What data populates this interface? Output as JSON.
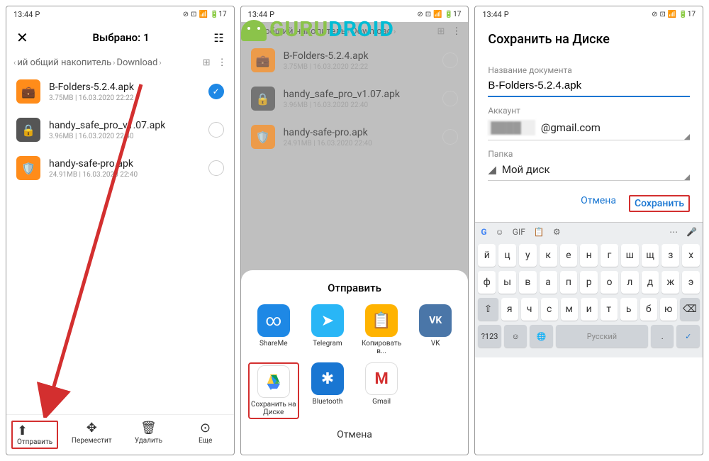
{
  "watermark": "GURUDROID",
  "status": {
    "time": "13:44",
    "carrier": "P",
    "battery": "17"
  },
  "screen1": {
    "title": "Выбрано: 1",
    "breadcrumb": {
      "part1": "ий общий накопитель",
      "part2": "Download"
    },
    "files": [
      {
        "name": "B-Folders-5.2.4.apk",
        "meta": "3.75MB | 16.03.2020 22:22",
        "icon": "orange",
        "checked": true
      },
      {
        "name": "handy_safe_pro_v1.07.apk",
        "meta": "3.96MB | 16.03.2020 22:40",
        "icon": "gray",
        "checked": false
      },
      {
        "name": "handy-safe-pro.apk",
        "meta": "24.91MB | 16.03.2020 22:40",
        "icon": "orange",
        "checked": false
      }
    ],
    "actions": {
      "send": "Отправить",
      "move": "Переместит",
      "delete": "Удалить",
      "more": "Еще"
    }
  },
  "screen2": {
    "breadcrumb": {
      "part1": "ий общий накопитель",
      "part2": "Download"
    },
    "files": [
      {
        "name": "B-Folders-5.2.4.apk",
        "meta": "3.75MB | 16.03.2020 22:22",
        "icon": "orange"
      },
      {
        "name": "handy_safe_pro_v1.07.apk",
        "meta": "3.96MB | 16.03.2020 22:40",
        "icon": "gray"
      },
      {
        "name": "handy-safe-pro.apk",
        "meta": "24.91MB | 16.03.2020 22:40",
        "icon": "orange"
      }
    ],
    "share": {
      "title": "Отправить",
      "apps": [
        {
          "name": "ShareMe",
          "color": "#1e88e5",
          "glyph": "∞"
        },
        {
          "name": "Telegram",
          "color": "#29b6f6",
          "glyph": "➤"
        },
        {
          "name": "Копировать в...",
          "color": "#ffb300",
          "glyph": "📋"
        },
        {
          "name": "VK",
          "color": "#4a76a8",
          "glyph": "VK"
        },
        {
          "name": "Сохранить на Диске",
          "color": "drive",
          "glyph": "△"
        },
        {
          "name": "Bluetooth",
          "color": "#1976d2",
          "glyph": "✱"
        },
        {
          "name": "Gmail",
          "color": "#fff",
          "glyph": "M"
        }
      ],
      "cancel": "Отмена"
    }
  },
  "screen3": {
    "title": "Сохранить на Диске",
    "docname": {
      "label": "Название документа",
      "value": "B-Folders-5.2.4.apk"
    },
    "account": {
      "label": "Аккаунт",
      "value": "@gmail.com"
    },
    "folder": {
      "label": "Папка",
      "value": "Мой диск"
    },
    "actions": {
      "cancel": "Отмена",
      "save": "Сохранить"
    },
    "keyboard": {
      "row1": [
        "й",
        "ц",
        "у",
        "к",
        "е",
        "н",
        "г",
        "ш",
        "щ",
        "з",
        "х"
      ],
      "row2": [
        "ф",
        "ы",
        "в",
        "а",
        "п",
        "р",
        "о",
        "л",
        "д",
        "ж",
        "э"
      ],
      "row3": [
        "я",
        "ч",
        "с",
        "м",
        "и",
        "т",
        "ь",
        "б",
        "ю"
      ],
      "space": "Русский",
      "numkey": "?123"
    }
  }
}
